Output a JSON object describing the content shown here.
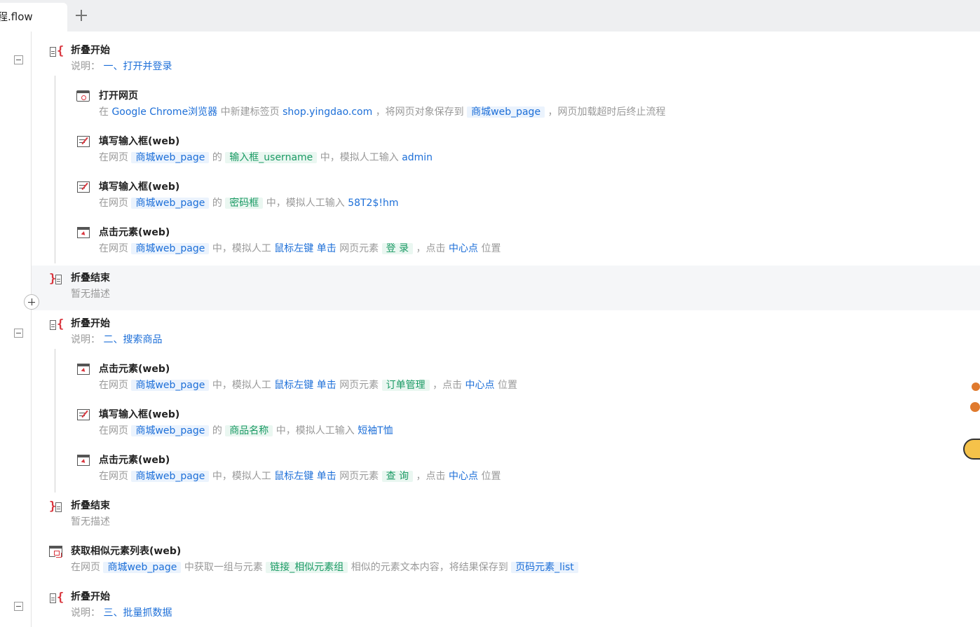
{
  "tab": {
    "title": "程.flow"
  },
  "steps": [
    {
      "title": "折叠开始",
      "desc_prefix": "说明：",
      "desc": "一、打开并登录"
    },
    {
      "title": "打开网页",
      "parts": [
        "在",
        "Google Chrome浏览器",
        "中新建标签页",
        "shop.yingdao.com",
        "，将网页对象保存到",
        "商城web_page",
        "，网页加载超时后终止流程"
      ]
    },
    {
      "title": "填写输入框(web)",
      "parts": [
        "在网页",
        "商城web_page",
        "的",
        "输入框_username",
        "中，模拟人工输入",
        "admin"
      ]
    },
    {
      "title": "填写输入框(web)",
      "parts": [
        "在网页",
        "商城web_page",
        "的",
        "密码框",
        "中，模拟人工输入",
        "58T2$!hm"
      ]
    },
    {
      "title": "点击元素(web)",
      "parts": [
        "在网页",
        "商城web_page",
        "中，模拟人工",
        "鼠标左键 单击",
        "网页元素",
        "登 录",
        "，点击",
        "中心点",
        "位置"
      ]
    },
    {
      "title": "折叠结束",
      "desc": "暂无描述"
    },
    {
      "title": "折叠开始",
      "desc_prefix": "说明：",
      "desc": "二、搜索商品"
    },
    {
      "title": "点击元素(web)",
      "parts": [
        "在网页",
        "商城web_page",
        "中，模拟人工",
        "鼠标左键 单击",
        "网页元素",
        "订单管理",
        "，点击",
        "中心点",
        "位置"
      ]
    },
    {
      "title": "填写输入框(web)",
      "parts": [
        "在网页",
        "商城web_page",
        "的",
        "商品名称",
        "中，模拟人工输入",
        "短袖T恤"
      ]
    },
    {
      "title": "点击元素(web)",
      "parts": [
        "在网页",
        "商城web_page",
        "中，模拟人工",
        "鼠标左键 单击",
        "网页元素",
        "查 询",
        "，点击",
        "中心点",
        "位置"
      ]
    },
    {
      "title": "折叠结束",
      "desc": "暂无描述"
    },
    {
      "title": "获取相似元素列表(web)",
      "parts": [
        "在网页",
        "商城web_page",
        "中获取一组与元素",
        "链接_相似元素组",
        "相似的元素文本内容，将结果保存到",
        "页码元素_list"
      ]
    },
    {
      "title": "折叠开始",
      "desc_prefix": "说明：",
      "desc": "三、批量抓数据"
    }
  ],
  "icons": {
    "fold_start": "fold-start-icon",
    "fold_end": "fold-end-icon",
    "web": "browser-icon",
    "edit": "input-edit-icon",
    "click": "click-icon",
    "list": "element-list-icon"
  },
  "colors": {
    "value_blue": "#1d6fd8",
    "element_green": "#1a9a64",
    "fold_red": "#d9363e",
    "desc_gray": "#999999"
  }
}
